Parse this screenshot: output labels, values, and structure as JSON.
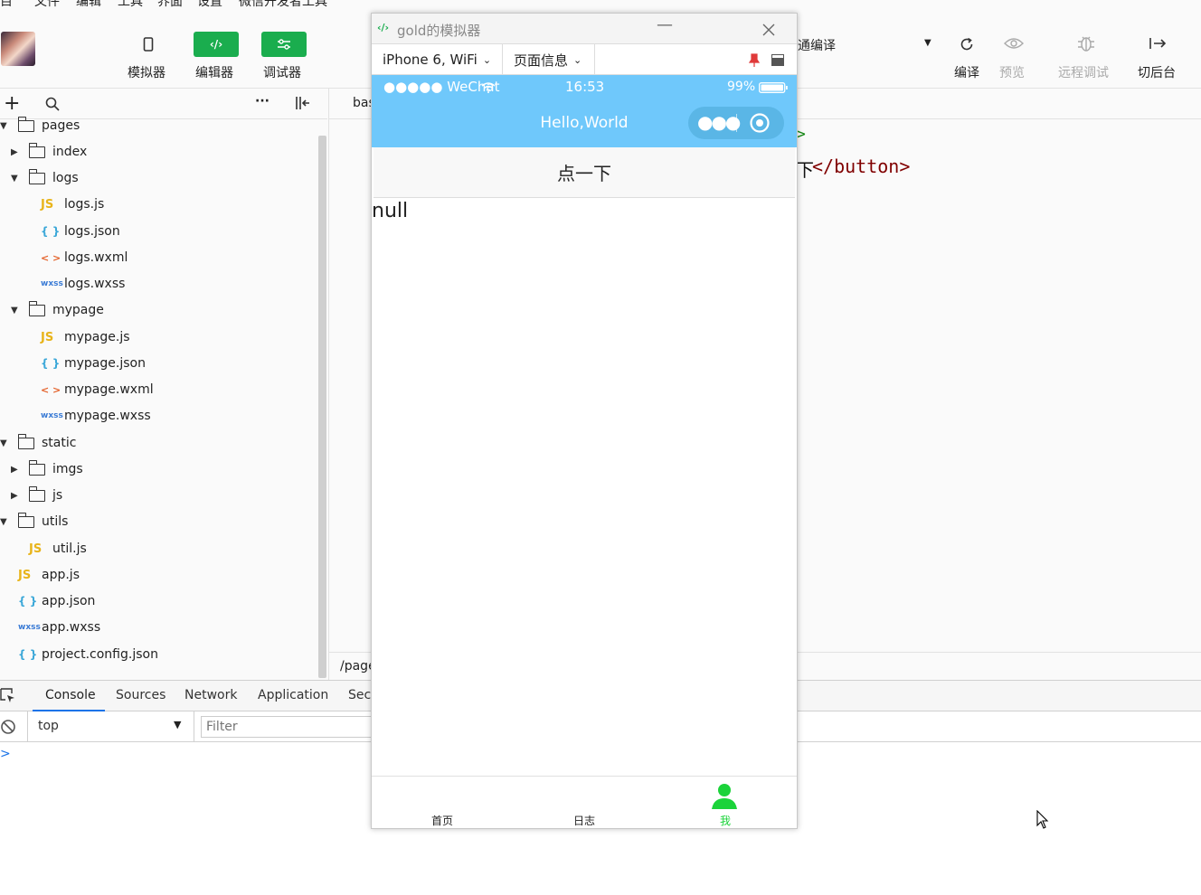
{
  "menu": [
    "项目",
    "文件",
    "编辑",
    "工具",
    "界面",
    "设置",
    "微信开发者工具"
  ],
  "toolbar": {
    "left_buttons": [
      {
        "label": "模拟器",
        "icon": "phone-icon"
      },
      {
        "label": "编辑器",
        "icon": "code-icon"
      },
      {
        "label": "调试器",
        "icon": "debug-icon"
      }
    ],
    "compile_mode": "普通编译",
    "right_buttons": [
      {
        "label": "编译",
        "icon": "refresh-icon"
      },
      {
        "label": "预览",
        "icon": "eye-icon"
      },
      {
        "label": "远程调试",
        "icon": "bug-icon"
      },
      {
        "label": "切后台",
        "icon": "switch-icon"
      }
    ]
  },
  "explorer": {
    "tree": [
      {
        "label": "pages",
        "kind": "folder",
        "open": true
      },
      {
        "label": "index",
        "kind": "folder",
        "open": false
      },
      {
        "label": "logs",
        "kind": "folder",
        "open": true
      },
      {
        "label": "logs.js",
        "kind": "js"
      },
      {
        "label": "logs.json",
        "kind": "json"
      },
      {
        "label": "logs.wxml",
        "kind": "wxml"
      },
      {
        "label": "logs.wxss",
        "kind": "wxss"
      },
      {
        "label": "mypage",
        "kind": "folder",
        "open": true
      },
      {
        "label": "mypage.js",
        "kind": "js"
      },
      {
        "label": "mypage.json",
        "kind": "json"
      },
      {
        "label": "mypage.wxml",
        "kind": "wxml"
      },
      {
        "label": "mypage.wxss",
        "kind": "wxss"
      },
      {
        "label": "static",
        "kind": "folder",
        "open": true
      },
      {
        "label": "imgs",
        "kind": "folder",
        "open": false
      },
      {
        "label": "js",
        "kind": "folder",
        "open": false
      },
      {
        "label": "utils",
        "kind": "folder",
        "open": true
      },
      {
        "label": "util.js",
        "kind": "js"
      },
      {
        "label": "app.js",
        "kind": "js"
      },
      {
        "label": "app.json",
        "kind": "json"
      },
      {
        "label": "app.wxss",
        "kind": "wxss"
      },
      {
        "label": "project.config.json",
        "kind": "json"
      }
    ],
    "filetype_glyphs": {
      "js": "JS",
      "json": "{ }",
      "wxml": "< >",
      "wxss": "wxss"
    }
  },
  "editor": {
    "tab_label": "bas",
    "code_gt": ">",
    "code_line_text": "下",
    "code_close_tag": "</button>",
    "path": "/page"
  },
  "simulator": {
    "window_title": "gold的模拟器",
    "device": "iPhone 6, WiFi",
    "page_info": "页面信息",
    "status": {
      "carrier": "●●●●● WeChat",
      "time": "16:53",
      "battery": "99%"
    },
    "nav_title": "Hello,World",
    "button_label": "点一下",
    "output_text": "null",
    "tabbar": [
      {
        "label": "首页",
        "active": false
      },
      {
        "label": "日志",
        "active": false
      },
      {
        "label": "我",
        "active": true
      }
    ]
  },
  "devtools": {
    "tabs": [
      "Console",
      "Sources",
      "Network",
      "Application",
      "Sec"
    ],
    "active_tab": "Console",
    "context": "top",
    "filter_placeholder": "Filter",
    "prompt": ">"
  },
  "colors": {
    "accent_green": "#1aad4e",
    "wechat_blue": "#6fc8fb",
    "tab_active": "#1bd33a",
    "devtools_blue": "#1a73e8"
  }
}
